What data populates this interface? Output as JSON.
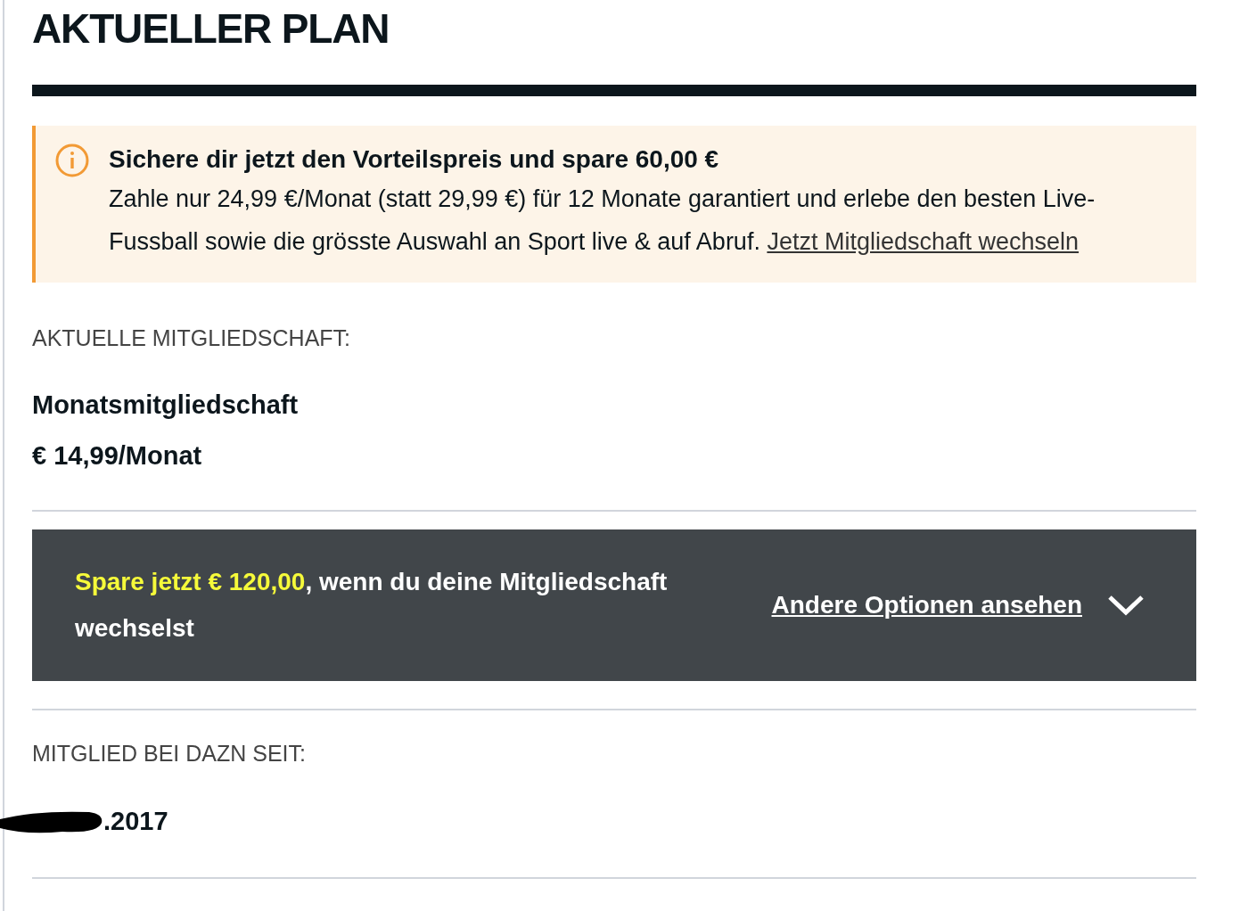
{
  "title": "AKTUELLER PLAN",
  "notice": {
    "headline": "Sichere dir jetzt den Vorteilspreis und spare 60,00 €",
    "body": "Zahle nur 24,99 €/Monat (statt 29,99 €) für 12 Monate garantiert und erlebe den besten Live-Fussball sowie die grösste Auswahl an Sport live & auf Abruf.",
    "link": "Jetzt Mitgliedschaft wechseln"
  },
  "membership": {
    "label": "AKTUELLE MITGLIEDSCHAFT:",
    "plan": "Monatsmitgliedschaft",
    "price": "€ 14,99/Monat"
  },
  "offer": {
    "highlight": "Spare jetzt € 120,00",
    "text": ", wenn du deine Mitgliedschaft wechselst",
    "link": "Andere Optionen ansehen",
    "expanded": false
  },
  "member_since": {
    "label": "MITGLIED BEI DAZN SEIT:",
    "date": ".2017",
    "redacted": true
  }
}
